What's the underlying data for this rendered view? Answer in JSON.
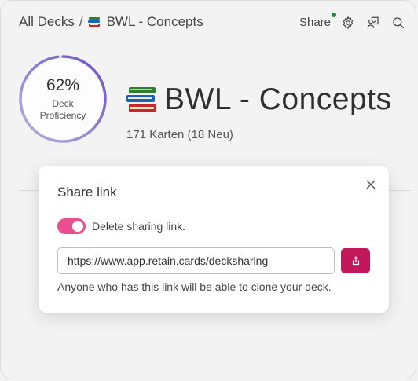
{
  "breadcrumb": {
    "root": "All Decks",
    "separator": "/",
    "current": "BWL - Concepts"
  },
  "toolbar": {
    "share_label": "Share",
    "icons": [
      "settings-gear-icon",
      "presentation-user-icon",
      "search-icon"
    ],
    "share_indicator_color": "#1e8c3a"
  },
  "proficiency": {
    "percent_text": "62%",
    "value": 0.62,
    "label": "Deck Proficiency"
  },
  "deck": {
    "title": "BWL - Concepts",
    "meta": "171 Karten (18 Neu)"
  },
  "modal": {
    "title": "Share link",
    "toggle_label": "Delete sharing link.",
    "toggle_on": true,
    "link_value": "https://www.app.retain.cards/decksharing",
    "hint": "Anyone who has this link will be able to clone your deck."
  },
  "colors": {
    "accent": "#e8508f",
    "copy_button": "#c2185b",
    "ring_start": "#b8b4de",
    "ring_end": "#6b4fc4"
  }
}
